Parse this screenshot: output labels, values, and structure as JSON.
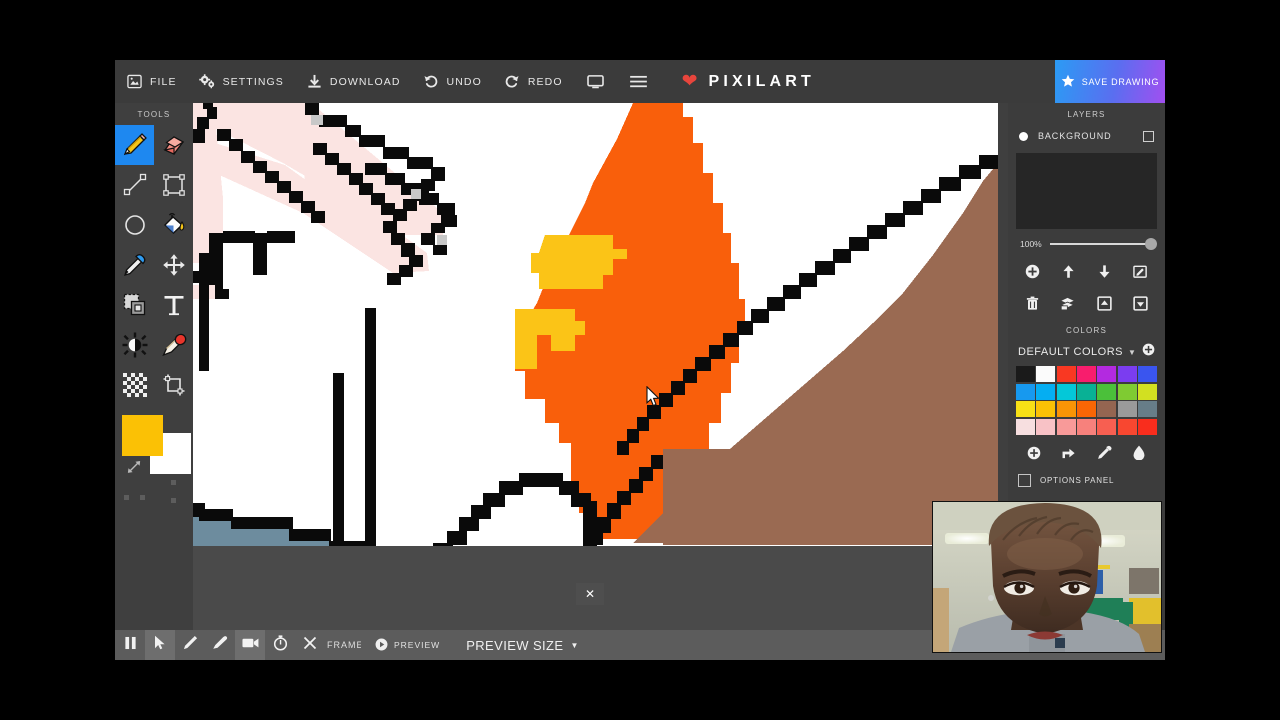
{
  "app": {
    "brand_name": "PIXILART",
    "brand_icon": "heart-icon"
  },
  "topbar": {
    "items": [
      {
        "label": "FILE",
        "icon": "file-icon"
      },
      {
        "label": "SETTINGS",
        "icon": "gears-icon"
      },
      {
        "label": "DOWNLOAD",
        "icon": "download-icon"
      },
      {
        "label": "UNDO",
        "icon": "undo-arrow-icon"
      },
      {
        "label": "REDO",
        "icon": "redo-arrow-icon"
      }
    ],
    "monitor_icon": "monitor-icon",
    "hamburger_icon": "hamburger-menu-icon",
    "save_label": "SAVE DRAWING",
    "save_icon": "star-icon",
    "save_gradient_from": "#2b9bf4",
    "save_gradient_to": "#a14ff0"
  },
  "tools": {
    "title": "TOOLS",
    "items": [
      {
        "name": "pencil-tool",
        "icon": "pencil-icon",
        "active": true
      },
      {
        "name": "eraser-tool",
        "icon": "eraser-icon",
        "active": false
      },
      {
        "name": "line-tool",
        "icon": "line-icon",
        "active": false
      },
      {
        "name": "rectangle-tool",
        "icon": "rectangle-icon",
        "active": false
      },
      {
        "name": "ellipse-tool",
        "icon": "circle-icon",
        "active": false
      },
      {
        "name": "paint-bucket-tool",
        "icon": "paint-bucket-icon",
        "active": false
      },
      {
        "name": "eyedropper-tool",
        "icon": "eyedropper-icon",
        "active": false
      },
      {
        "name": "move-tool",
        "icon": "move-arrows-icon",
        "active": false
      },
      {
        "name": "select-tool",
        "icon": "marquee-select-icon",
        "active": false
      },
      {
        "name": "text-tool",
        "icon": "text-t-icon",
        "active": false
      },
      {
        "name": "lighten-darken-tool",
        "icon": "brightness-icon",
        "active": false
      },
      {
        "name": "smudge-tool",
        "icon": "smudge-brush-icon",
        "active": false
      },
      {
        "name": "dither-tool",
        "icon": "checker-dither-icon",
        "active": false
      },
      {
        "name": "crop-tool",
        "icon": "crop-icon",
        "active": false
      }
    ],
    "primary_color": "#fbc105",
    "secondary_color": "#ffffff",
    "swap_icon": "swap-colors-icon"
  },
  "layers": {
    "title": "LAYERS",
    "rows": [
      {
        "name": "BACKGROUND",
        "visible_icon": "visibility-dot-icon",
        "checkbox_icon": "checkbox-icon"
      }
    ],
    "opacity_value": "100%",
    "actions_row1": [
      {
        "name": "add-layer-button",
        "icon": "plus-circle-icon"
      },
      {
        "name": "move-layer-up-button",
        "icon": "arrow-up-icon"
      },
      {
        "name": "move-layer-down-button",
        "icon": "arrow-down-icon"
      },
      {
        "name": "edit-layer-button",
        "icon": "edit-square-icon"
      }
    ],
    "actions_row2": [
      {
        "name": "delete-layer-button",
        "icon": "trash-icon"
      },
      {
        "name": "duplicate-layer-button",
        "icon": "copy-layers-icon"
      },
      {
        "name": "merge-up-button",
        "icon": "merge-up-icon"
      },
      {
        "name": "merge-down-button",
        "icon": "merge-down-icon"
      }
    ]
  },
  "colors": {
    "title": "COLORS",
    "palette_name": "DEFAULT COLORS",
    "caret_icon": "chevron-down-icon",
    "add_palette_icon": "plus-circle-icon",
    "swatches": [
      "#1a1a1a",
      "#fbfbfb",
      "#f93822",
      "#f81d6d",
      "#b32ae0",
      "#7b3df0",
      "#3a55ef",
      "#1799ef",
      "#05aef2",
      "#04c8d8",
      "#09b195",
      "#4bc03a",
      "#7fcb32",
      "#d2e021",
      "#f8e016",
      "#fbc105",
      "#f99406",
      "#f96605",
      "#946551",
      "#9a9a9a",
      "#677d88",
      "#f7dfe0",
      "#f8c2c6",
      "#f89a99",
      "#f7817c",
      "#f75f51",
      "#f84730",
      "#f92d1d"
    ],
    "tools": [
      {
        "name": "add-color-button",
        "icon": "plus-circle-icon"
      },
      {
        "name": "share-palette-button",
        "icon": "share-arrow-icon"
      },
      {
        "name": "pick-color-button",
        "icon": "eyedropper-icon"
      },
      {
        "name": "color-drop-button",
        "icon": "water-drop-icon"
      }
    ],
    "options_panel_label": "OPTIONS PANEL"
  },
  "bottombar": {
    "buttons": [
      {
        "name": "pause-button",
        "icon": "pause-icon",
        "highlighted": false
      },
      {
        "name": "select-cursor-button",
        "icon": "cursor-arrow-icon",
        "highlighted": true
      },
      {
        "name": "pen-button",
        "icon": "pen-icon",
        "highlighted": false
      },
      {
        "name": "brush-button",
        "icon": "brush-icon",
        "highlighted": false
      },
      {
        "name": "video-record-button",
        "icon": "video-camera-icon",
        "highlighted": true
      },
      {
        "name": "timer-button",
        "icon": "stopwatch-icon",
        "highlighted": false
      },
      {
        "name": "close-button",
        "icon": "x-close-icon",
        "highlighted": false
      }
    ],
    "frame_label": "FRAME",
    "preview_label": "PREVIEW",
    "preview_icon": "play-circle-icon",
    "preview_size_label": "PREVIEW SIZE",
    "preview_size_caret": "chevron-down-icon"
  },
  "canvas": {
    "close_overlay_icon": "x-close-icon",
    "cursor_icon": "mouse-pointer-icon",
    "background": "#ffffff",
    "art_colors": {
      "outline": "#0a0a0a",
      "skin_pink": "#fbe4e2",
      "flame_orange": "#f95f0b",
      "flame_yellow": "#fbc417",
      "mountain_brown": "#9a6a52",
      "water_blue": "#6d8c9e"
    }
  },
  "webcam": {
    "label": "webcam-overlay"
  }
}
